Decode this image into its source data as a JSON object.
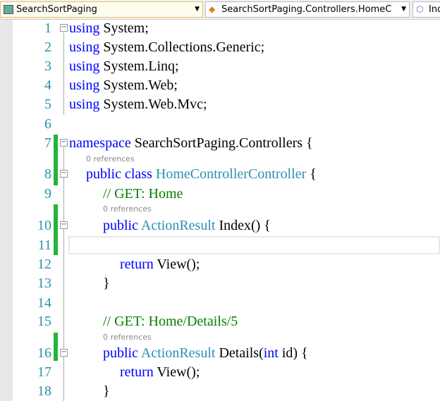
{
  "nav": {
    "project": "SearchSortPaging",
    "class": "SearchSortPaging.Controllers.HomeC",
    "member": "Index"
  },
  "refs": "0 references",
  "lines": {
    "n": [
      "1",
      "2",
      "3",
      "4",
      "5",
      "6",
      "7",
      "8",
      "9",
      "10",
      "11",
      "12",
      "13",
      "14",
      "15",
      "16",
      "17",
      "18"
    ],
    "l1a": "using",
    "l1b": " System;",
    "l2a": "using",
    "l2b": " System.Collections.Generic;",
    "l3a": "using",
    "l3b": " System.Linq;",
    "l4a": "using",
    "l4b": " System.Web;",
    "l5a": "using",
    "l5b": " System.Web.Mvc;",
    "l7a": "namespace",
    "l7b": " SearchSortPaging.Controllers {",
    "l8a": "public class ",
    "l8b": "HomeController",
    ": ": ": ",
    "l8c": "Controller",
    "l8d": " {",
    "l9": "// GET: Home",
    "l10a": "public ",
    "l10b": "ActionResult",
    "l10c": " Index() {",
    "l12": "return View();",
    "l12a": "return",
    "l12b": " View();",
    "l13": "}",
    "l15": "// GET: Home/Details/5",
    "l16a": "public ",
    "l16b": "ActionResult",
    "l16c": " Details(",
    "l16d": "int",
    "l16e": " id) {",
    "l17a": "return",
    "l17b": " View();",
    "l18": "}"
  }
}
